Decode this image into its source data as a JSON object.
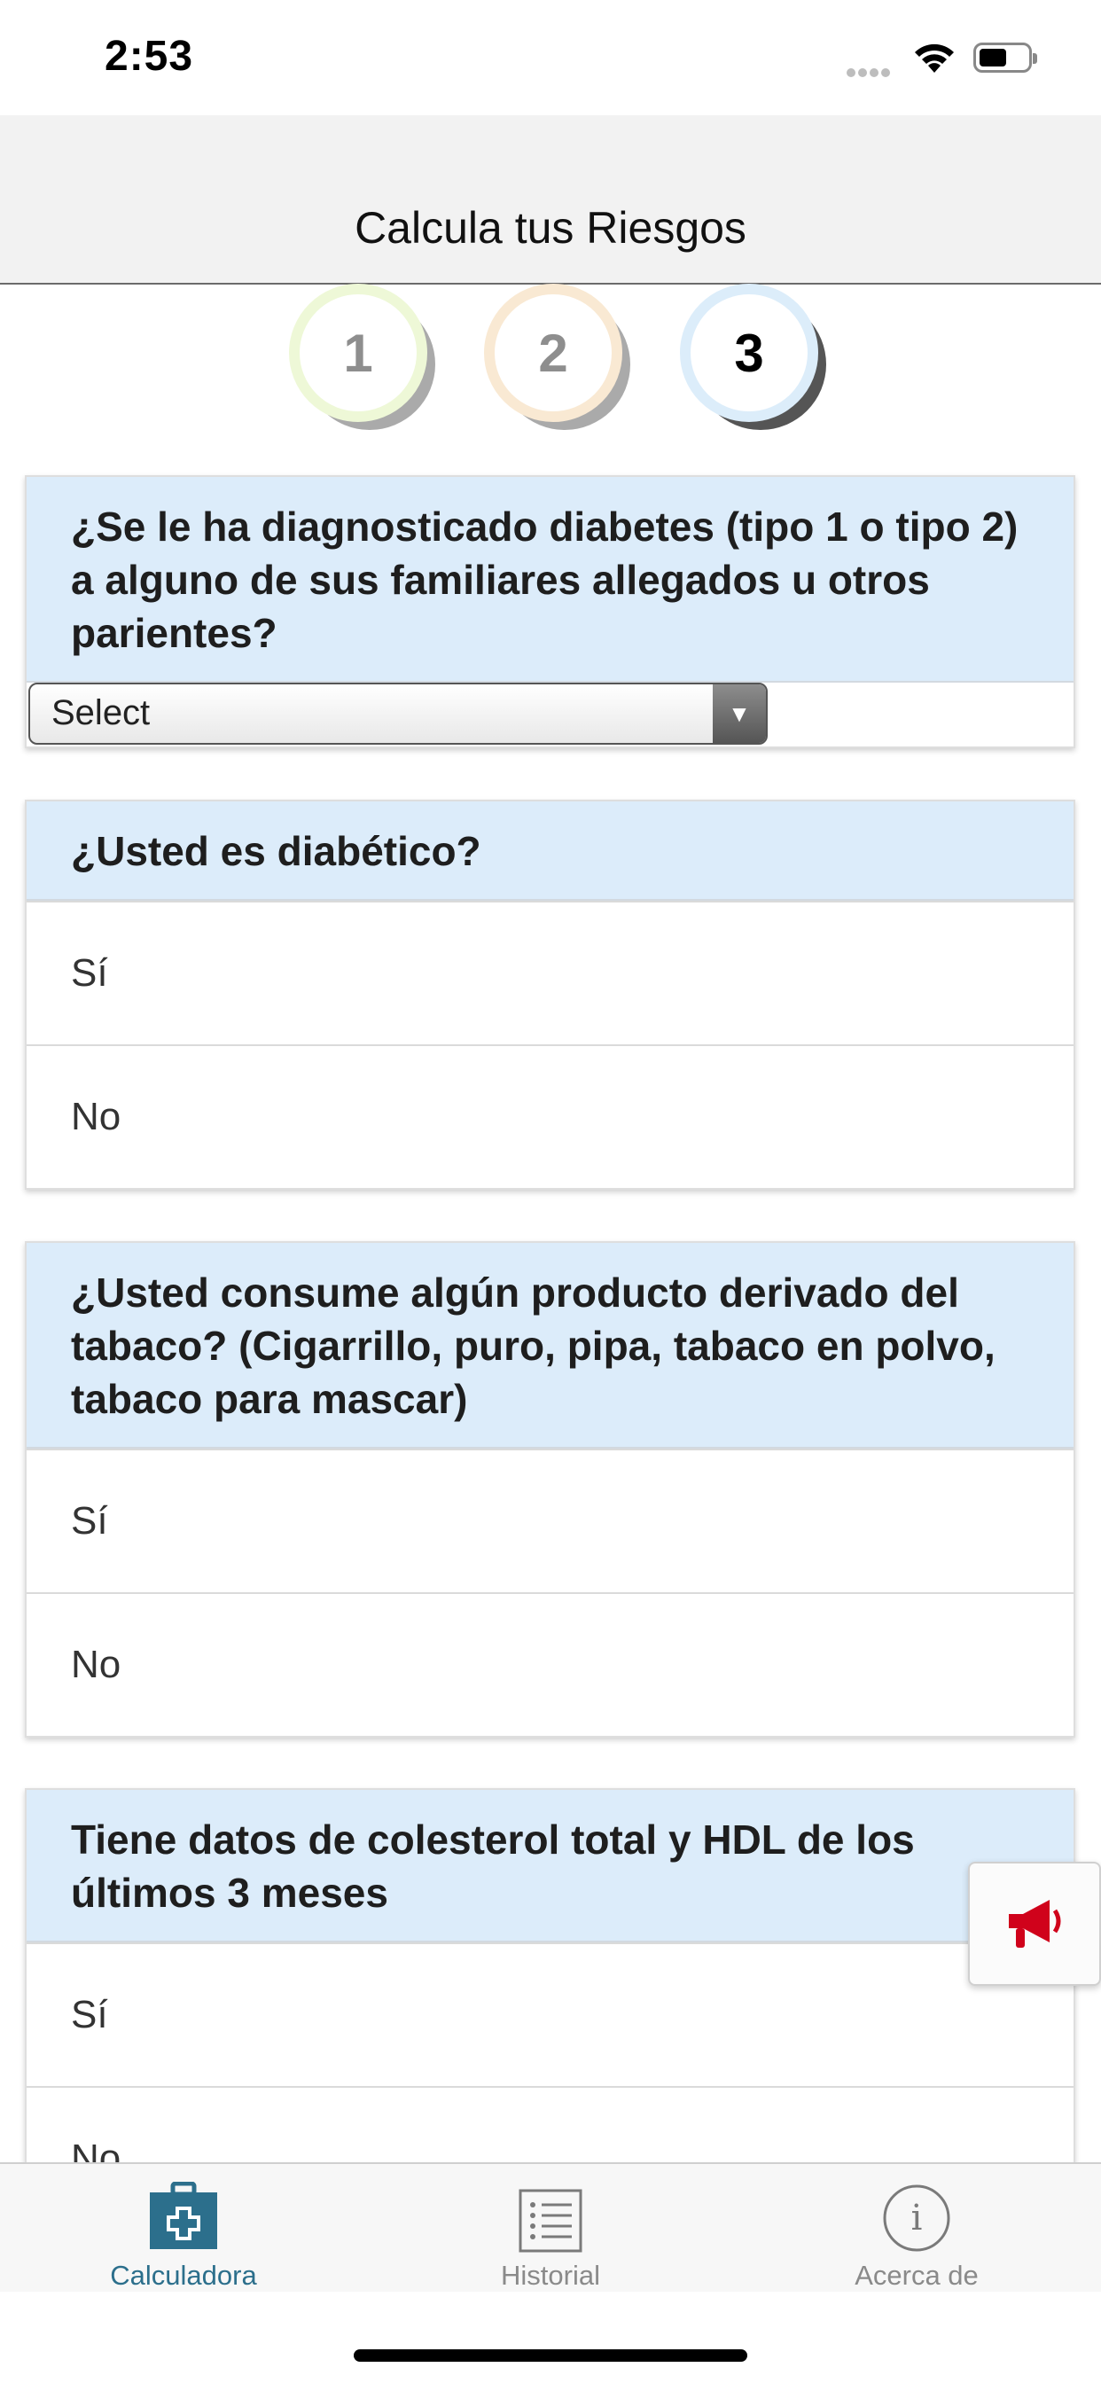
{
  "status_bar": {
    "time": "2:53"
  },
  "header": {
    "title": "Calcula tus Riesgos"
  },
  "steps": [
    {
      "number": "1",
      "state": "completed"
    },
    {
      "number": "2",
      "state": "completed"
    },
    {
      "number": "3",
      "state": "active"
    }
  ],
  "questions": [
    {
      "text": "¿Se le ha diagnosticado diabetes (tipo 1 o tipo 2) a alguno de sus familiares allegados u otros parientes?",
      "select": {
        "value": "Select"
      }
    },
    {
      "text": "¿Usted es diabético?",
      "options": [
        "Sí",
        "No"
      ]
    },
    {
      "text": "¿Usted consume algún producto derivado del tabaco? (Cigarrillo, puro, pipa, tabaco en polvo, tabaco para mascar)",
      "options": [
        "Sí",
        "No"
      ]
    },
    {
      "text": "Tiene datos de colesterol total y HDL de los últimos 3 meses",
      "options": [
        "Sí",
        "No"
      ]
    }
  ],
  "tabbar": {
    "items": [
      {
        "label": "Calculadora",
        "icon": "medical-kit-icon",
        "active": true
      },
      {
        "label": "Historial",
        "icon": "list-icon",
        "active": false
      },
      {
        "label": "Acerca de",
        "icon": "info-icon",
        "active": false
      }
    ]
  },
  "colors": {
    "card_header": "#dcecfa",
    "active_tab": "#2c6f8c",
    "megaphone": "#d0021b"
  }
}
